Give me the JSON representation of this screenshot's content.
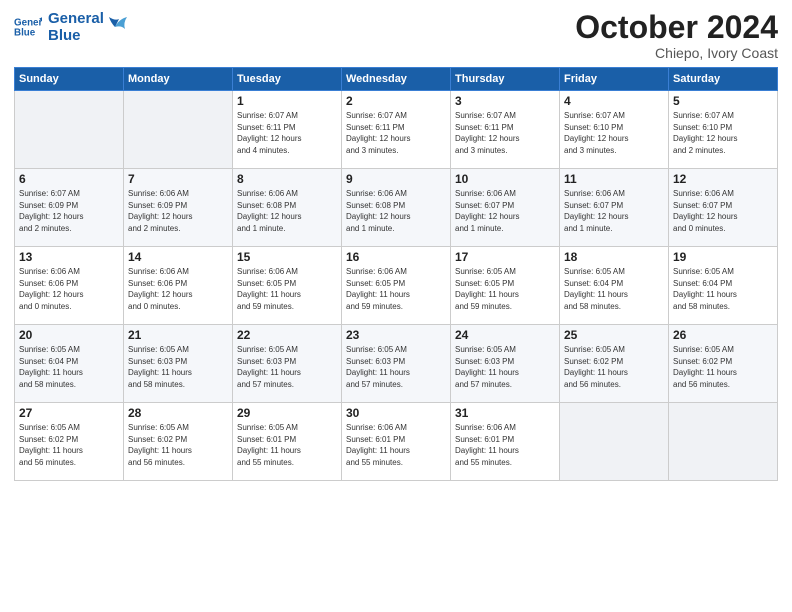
{
  "header": {
    "logo_general": "General",
    "logo_blue": "Blue",
    "month": "October 2024",
    "location": "Chiepo, Ivory Coast"
  },
  "weekdays": [
    "Sunday",
    "Monday",
    "Tuesday",
    "Wednesday",
    "Thursday",
    "Friday",
    "Saturday"
  ],
  "weeks": [
    [
      {
        "day": "",
        "info": ""
      },
      {
        "day": "",
        "info": ""
      },
      {
        "day": "1",
        "info": "Sunrise: 6:07 AM\nSunset: 6:11 PM\nDaylight: 12 hours\nand 4 minutes."
      },
      {
        "day": "2",
        "info": "Sunrise: 6:07 AM\nSunset: 6:11 PM\nDaylight: 12 hours\nand 3 minutes."
      },
      {
        "day": "3",
        "info": "Sunrise: 6:07 AM\nSunset: 6:11 PM\nDaylight: 12 hours\nand 3 minutes."
      },
      {
        "day": "4",
        "info": "Sunrise: 6:07 AM\nSunset: 6:10 PM\nDaylight: 12 hours\nand 3 minutes."
      },
      {
        "day": "5",
        "info": "Sunrise: 6:07 AM\nSunset: 6:10 PM\nDaylight: 12 hours\nand 2 minutes."
      }
    ],
    [
      {
        "day": "6",
        "info": "Sunrise: 6:07 AM\nSunset: 6:09 PM\nDaylight: 12 hours\nand 2 minutes."
      },
      {
        "day": "7",
        "info": "Sunrise: 6:06 AM\nSunset: 6:09 PM\nDaylight: 12 hours\nand 2 minutes."
      },
      {
        "day": "8",
        "info": "Sunrise: 6:06 AM\nSunset: 6:08 PM\nDaylight: 12 hours\nand 1 minute."
      },
      {
        "day": "9",
        "info": "Sunrise: 6:06 AM\nSunset: 6:08 PM\nDaylight: 12 hours\nand 1 minute."
      },
      {
        "day": "10",
        "info": "Sunrise: 6:06 AM\nSunset: 6:07 PM\nDaylight: 12 hours\nand 1 minute."
      },
      {
        "day": "11",
        "info": "Sunrise: 6:06 AM\nSunset: 6:07 PM\nDaylight: 12 hours\nand 1 minute."
      },
      {
        "day": "12",
        "info": "Sunrise: 6:06 AM\nSunset: 6:07 PM\nDaylight: 12 hours\nand 0 minutes."
      }
    ],
    [
      {
        "day": "13",
        "info": "Sunrise: 6:06 AM\nSunset: 6:06 PM\nDaylight: 12 hours\nand 0 minutes."
      },
      {
        "day": "14",
        "info": "Sunrise: 6:06 AM\nSunset: 6:06 PM\nDaylight: 12 hours\nand 0 minutes."
      },
      {
        "day": "15",
        "info": "Sunrise: 6:06 AM\nSunset: 6:05 PM\nDaylight: 11 hours\nand 59 minutes."
      },
      {
        "day": "16",
        "info": "Sunrise: 6:06 AM\nSunset: 6:05 PM\nDaylight: 11 hours\nand 59 minutes."
      },
      {
        "day": "17",
        "info": "Sunrise: 6:05 AM\nSunset: 6:05 PM\nDaylight: 11 hours\nand 59 minutes."
      },
      {
        "day": "18",
        "info": "Sunrise: 6:05 AM\nSunset: 6:04 PM\nDaylight: 11 hours\nand 58 minutes."
      },
      {
        "day": "19",
        "info": "Sunrise: 6:05 AM\nSunset: 6:04 PM\nDaylight: 11 hours\nand 58 minutes."
      }
    ],
    [
      {
        "day": "20",
        "info": "Sunrise: 6:05 AM\nSunset: 6:04 PM\nDaylight: 11 hours\nand 58 minutes."
      },
      {
        "day": "21",
        "info": "Sunrise: 6:05 AM\nSunset: 6:03 PM\nDaylight: 11 hours\nand 58 minutes."
      },
      {
        "day": "22",
        "info": "Sunrise: 6:05 AM\nSunset: 6:03 PM\nDaylight: 11 hours\nand 57 minutes."
      },
      {
        "day": "23",
        "info": "Sunrise: 6:05 AM\nSunset: 6:03 PM\nDaylight: 11 hours\nand 57 minutes."
      },
      {
        "day": "24",
        "info": "Sunrise: 6:05 AM\nSunset: 6:03 PM\nDaylight: 11 hours\nand 57 minutes."
      },
      {
        "day": "25",
        "info": "Sunrise: 6:05 AM\nSunset: 6:02 PM\nDaylight: 11 hours\nand 56 minutes."
      },
      {
        "day": "26",
        "info": "Sunrise: 6:05 AM\nSunset: 6:02 PM\nDaylight: 11 hours\nand 56 minutes."
      }
    ],
    [
      {
        "day": "27",
        "info": "Sunrise: 6:05 AM\nSunset: 6:02 PM\nDaylight: 11 hours\nand 56 minutes."
      },
      {
        "day": "28",
        "info": "Sunrise: 6:05 AM\nSunset: 6:02 PM\nDaylight: 11 hours\nand 56 minutes."
      },
      {
        "day": "29",
        "info": "Sunrise: 6:05 AM\nSunset: 6:01 PM\nDaylight: 11 hours\nand 55 minutes."
      },
      {
        "day": "30",
        "info": "Sunrise: 6:06 AM\nSunset: 6:01 PM\nDaylight: 11 hours\nand 55 minutes."
      },
      {
        "day": "31",
        "info": "Sunrise: 6:06 AM\nSunset: 6:01 PM\nDaylight: 11 hours\nand 55 minutes."
      },
      {
        "day": "",
        "info": ""
      },
      {
        "day": "",
        "info": ""
      }
    ]
  ]
}
